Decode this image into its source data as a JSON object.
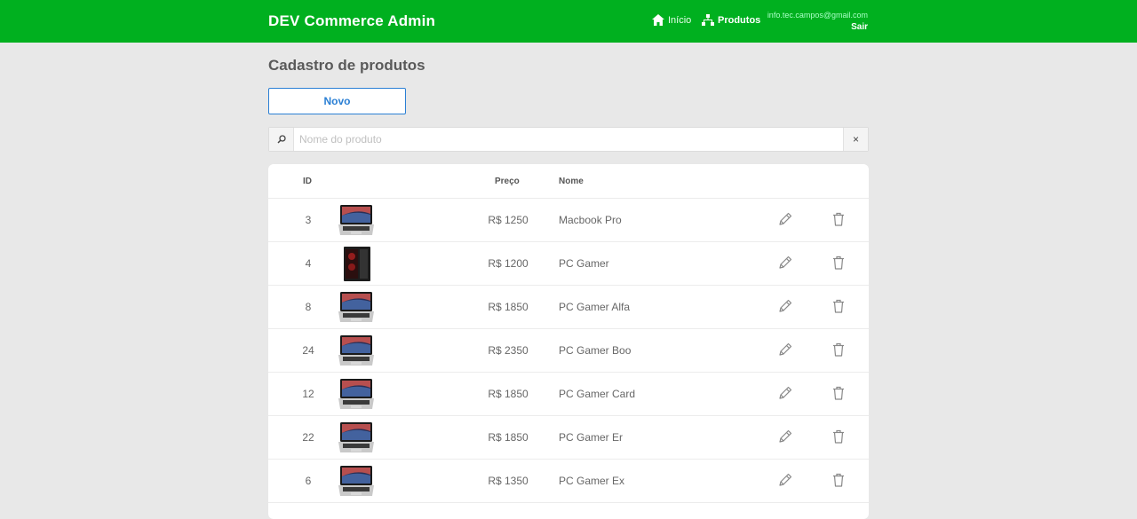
{
  "header": {
    "brand": "DEV Commerce Admin",
    "nav_home": "Início",
    "nav_products": "Produtos",
    "user_email": "info.tec.campos@gmail.com",
    "logout": "Sair",
    "accent_color": "#00b01f"
  },
  "main": {
    "title": "Cadastro de produtos",
    "new_button": "Novo",
    "search": {
      "placeholder": "Nome do produto",
      "clear_label": "×"
    },
    "table": {
      "headers": {
        "id": "ID",
        "price": "Preço",
        "name": "Nome"
      },
      "rows": [
        {
          "id": "3",
          "price": "R$ 1250",
          "name": "Macbook Pro",
          "image": "laptop-image"
        },
        {
          "id": "4",
          "price": "R$ 1200",
          "name": "PC Gamer",
          "image": "pc-tower-image"
        },
        {
          "id": "8",
          "price": "R$ 1850",
          "name": "PC Gamer Alfa",
          "image": "laptop-image"
        },
        {
          "id": "24",
          "price": "R$ 2350",
          "name": "PC Gamer Boo",
          "image": "laptop-image"
        },
        {
          "id": "12",
          "price": "R$ 1850",
          "name": "PC Gamer Card",
          "image": "laptop-image"
        },
        {
          "id": "22",
          "price": "R$ 1850",
          "name": "PC Gamer Er",
          "image": "laptop-image"
        },
        {
          "id": "6",
          "price": "R$ 1350",
          "name": "PC Gamer Ex",
          "image": "laptop-image"
        }
      ]
    }
  }
}
